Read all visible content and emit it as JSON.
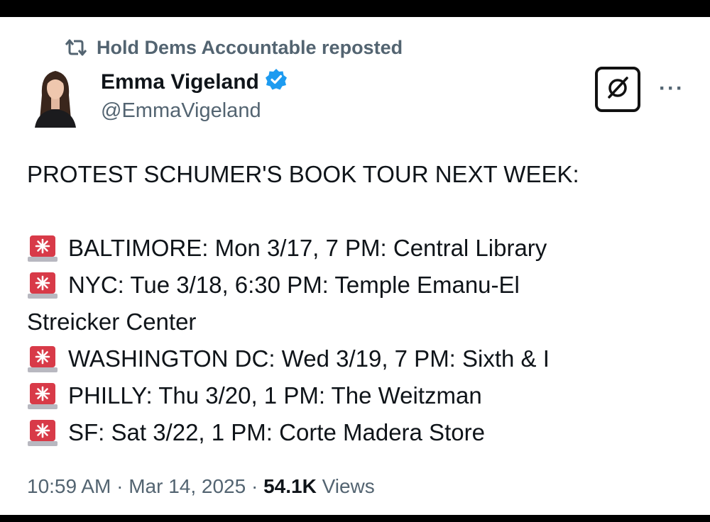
{
  "repost": {
    "icon": "retweet-icon",
    "text": "Hold Dems Accountable reposted"
  },
  "author": {
    "avatar_icon": "avatar",
    "name": "Emma Vigeland",
    "verified_icon": "verified-badge-icon",
    "handle": "@EmmaVigeland"
  },
  "actions": {
    "grok_icon": "grok-icon",
    "more_label": "···"
  },
  "tweet": {
    "headline": "PROTEST SCHUMER'S BOOK TOUR NEXT WEEK:",
    "siren_icon": "police-light-icon",
    "events": [
      "BALTIMORE: Mon 3/17, 7 PM: Central Library",
      "NYC: Tue 3/18, 6:30 PM: Temple Emanu-El",
      "WASHINGTON DC: Wed 3/19, 7 PM: Sixth & I",
      "PHILLY: Thu 3/20, 1 PM: The Weitzman",
      "SF: Sat 3/22, 1 PM: Corte Madera Store"
    ],
    "nyc_continuation": "Streicker Center"
  },
  "footer": {
    "time": "10:59 AM",
    "separator": "·",
    "date": "Mar 14, 2025",
    "views_count": "54.1K",
    "views_label": "Views"
  },
  "colors": {
    "text_primary": "#0f1419",
    "text_secondary": "#536471",
    "verified_blue": "#1d9bf0",
    "siren_red": "#d83a48"
  }
}
